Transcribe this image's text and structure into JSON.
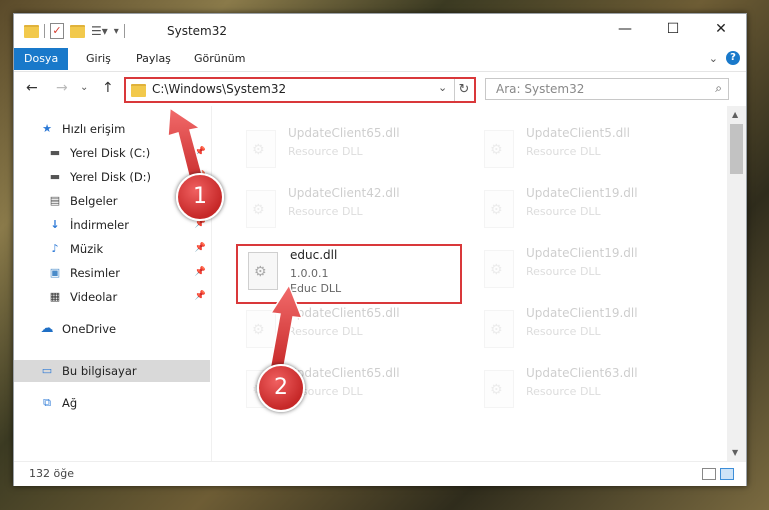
{
  "window": {
    "title": "System32",
    "minimize": "—",
    "maximize": "☐",
    "close": "✕"
  },
  "ribbon": {
    "tabs": [
      "Dosya",
      "Giriş",
      "Paylaş",
      "Görünüm"
    ],
    "collapse": "⌄",
    "help": "?"
  },
  "nav": {
    "back": "←",
    "forward": "→",
    "recent": "⌄",
    "up": "↑",
    "address": "C:\\Windows\\System32",
    "address_drop": "⌄",
    "refresh": "↻",
    "search_placeholder": "Ara: System32",
    "search_icon": "⌕"
  },
  "sidebar": {
    "items": [
      {
        "label": "Hızlı erişim",
        "icon": "star-icon",
        "glyph": "★",
        "color": "#2b78d6"
      },
      {
        "label": "Yerel Disk (C:)",
        "icon": "drive-icon",
        "glyph": "▬",
        "color": "#555"
      },
      {
        "label": "Yerel Disk (D:)",
        "icon": "drive-icon",
        "glyph": "▬",
        "color": "#555"
      },
      {
        "label": "Belgeler",
        "icon": "document-icon",
        "glyph": "▤",
        "color": "#555"
      },
      {
        "label": "İndirmeler",
        "icon": "download-icon",
        "glyph": "↓",
        "color": "#2b78d6"
      },
      {
        "label": "Müzik",
        "icon": "music-icon",
        "glyph": "♪",
        "color": "#2b78d6"
      },
      {
        "label": "Resimler",
        "icon": "pictures-icon",
        "glyph": "▣",
        "color": "#4a8bc9"
      },
      {
        "label": "Videolar",
        "icon": "video-icon",
        "glyph": "▦",
        "color": "#333"
      },
      {
        "label": "OneDrive",
        "icon": "cloud-icon",
        "glyph": "☁",
        "color": "#1f6fc5"
      },
      {
        "label": "Bu bilgisayar",
        "icon": "computer-icon",
        "glyph": "▭",
        "color": "#2b78d6"
      },
      {
        "label": "Ağ",
        "icon": "network-icon",
        "glyph": "⧉",
        "color": "#2b78d6"
      }
    ],
    "pin": "📌"
  },
  "files": [
    {
      "name": "UpdateClient65.dll",
      "line1": "Resource DLL",
      "line2": ""
    },
    {
      "name": "UpdateClient5.dll",
      "line1": "Resource DLL",
      "line2": ""
    },
    {
      "name": "UpdateClient42.dll",
      "line1": "Resource DLL",
      "line2": ""
    },
    {
      "name": "UpdateClient19.dll",
      "line1": "Resource DLL",
      "line2": ""
    },
    {
      "name": "educ.dll",
      "line1": "1.0.0.1",
      "line2": "Educ DLL"
    },
    {
      "name": "UpdateClient19.dll",
      "line1": "Resource DLL",
      "line2": ""
    },
    {
      "name": "UpdateClient65.dll",
      "line1": "Resource DLL",
      "line2": ""
    },
    {
      "name": "UpdateClient19.dll",
      "line1": "Resource DLL",
      "line2": ""
    },
    {
      "name": "UpdateClient65.dll",
      "line1": "Resource DLL",
      "line2": ""
    },
    {
      "name": "UpdateClient63.dll",
      "line1": "Resource DLL",
      "line2": ""
    }
  ],
  "status": {
    "count": "132 öğe"
  },
  "annotations": {
    "badge1": "1",
    "badge2": "2",
    "accent": "#d9383a"
  }
}
